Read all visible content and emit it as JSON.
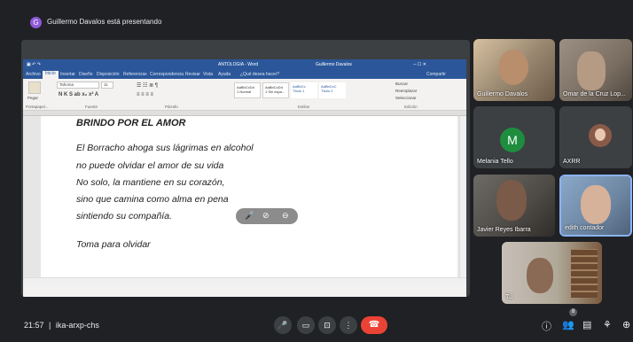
{
  "banner": {
    "avatar_letter": "G",
    "presenting_text": "Guillermo Davalos está presentando"
  },
  "word": {
    "title_left": "ANTOLOGIA - Word",
    "title_user": "Guillermo Davalos",
    "tabs": [
      "Archivo",
      "Inicio",
      "Insertar",
      "Diseño",
      "Disposición",
      "Referencias",
      "Correspondencia",
      "Revisar",
      "Vista",
      "Ayuda",
      "¿Qué desea hacer?"
    ],
    "share_label": "Compartir",
    "font_name": "Tahoma",
    "font_size": "11",
    "paste_label": "Pegar",
    "groups": [
      "Portapapel...",
      "Fuente",
      "Párrafo",
      "Estilos",
      "Edición"
    ],
    "styles": [
      {
        "sample": "AaBbCcDd",
        "name": "1 Normal"
      },
      {
        "sample": "AaBbCcDd",
        "name": "1 Sin espa..."
      },
      {
        "sample": "AaBbCc",
        "name": "Título 1"
      },
      {
        "sample": "AaBbCcC",
        "name": "Título 2"
      }
    ],
    "editing": [
      "Buscar",
      "Reemplazar",
      "Seleccionar"
    ],
    "doc_lines": [
      "BRINDO POR EL AMOR",
      "El Borracho ahoga sus lágrimas en alcohol",
      "no puede olvidar el amor de su vida",
      "No solo, la mantiene en su corazón,",
      "sino que camina como alma en pena",
      "sintiendo su compañía.",
      "Toma para olvidar"
    ]
  },
  "participants": [
    {
      "name": "Guillermo Davalos"
    },
    {
      "name": "Omar de la Cruz Lop..."
    },
    {
      "name": "Melania Tello",
      "initial": "M"
    },
    {
      "name": "AXRR"
    },
    {
      "name": "Javier Reyes Ibarra"
    },
    {
      "name": "edith contador"
    },
    {
      "name": "Tú"
    }
  ],
  "meeting": {
    "time": "21:57",
    "separator": "|",
    "code": "ika-arxp-chs",
    "participant_badge": "8"
  },
  "colors": {
    "hangup": "#ea4335",
    "word_blue": "#2b579a",
    "melania_avatar": "#1e8e3e",
    "presenter_avatar": "#8e5ad8"
  }
}
